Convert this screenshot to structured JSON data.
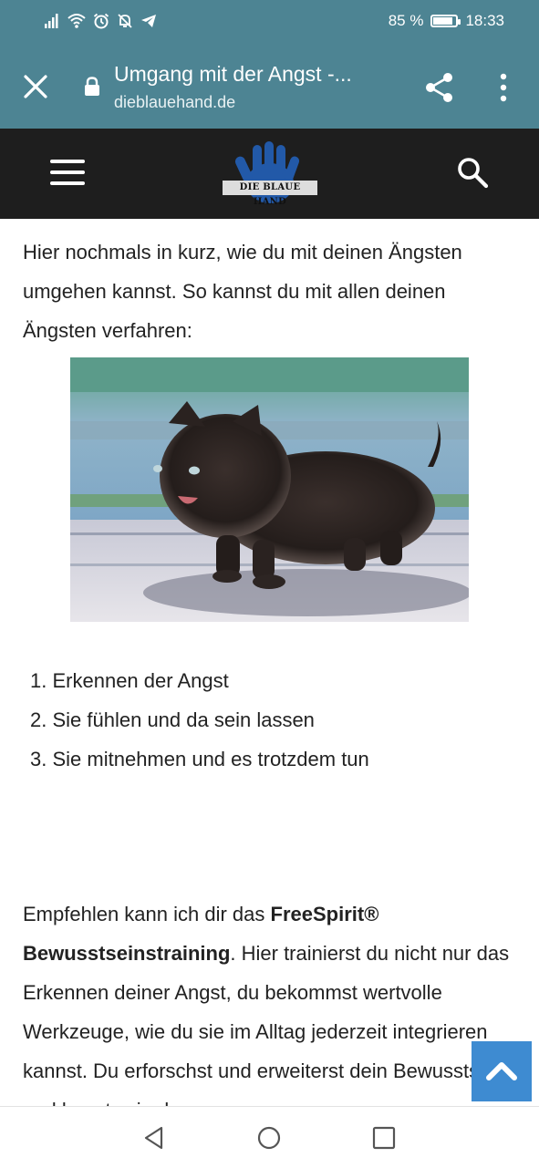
{
  "status_bar": {
    "battery_percent": "85 %",
    "battery_level": 0.85,
    "time": "18:33",
    "icons": [
      "signal-icon",
      "wifi-icon",
      "alarm-icon",
      "mute-icon",
      "telegram-icon"
    ]
  },
  "browser": {
    "page_title": "Umgang mit der Angst -...",
    "url": "dieblauehand.de",
    "toolbar_color": "#4d8493"
  },
  "site_header": {
    "logo_text": "DIE BLAUE HAND",
    "background": "#1e1e1e"
  },
  "article": {
    "intro": "Hier nochmals in kurz, wie du mit deinen Ängsten umgehen kannst. So kannst du mit allen deinen Ängsten verfahren:",
    "steps": [
      {
        "number": "1.",
        "text": "Erkennen der Angst"
      },
      {
        "number": "2.",
        "text": "Sie fühlen und da sein lassen"
      },
      {
        "number": "3.",
        "text": "Sie mitnehmen und es trotzdem tun"
      }
    ],
    "recommend": {
      "lead": "Empfehlen kann ich dir das ",
      "brand": "FreeSpirit®",
      "brand_training": "Bewusstseinstraining",
      "rest": ". Hier trainierst du nicht nur das Erkennen deiner Angst, du bekommst wertvolle Werkzeuge, wie du sie im Alltag jederzeit integrieren kannst. Du erforschst und erweiterst dein Bewusstsein und lernst, wie du"
    }
  },
  "scroll_up": {
    "icon": "chevron-up-icon",
    "color": "#3e8bd1"
  },
  "nav_bar": {
    "icons": [
      "back-icon",
      "home-icon",
      "recents-icon"
    ]
  }
}
